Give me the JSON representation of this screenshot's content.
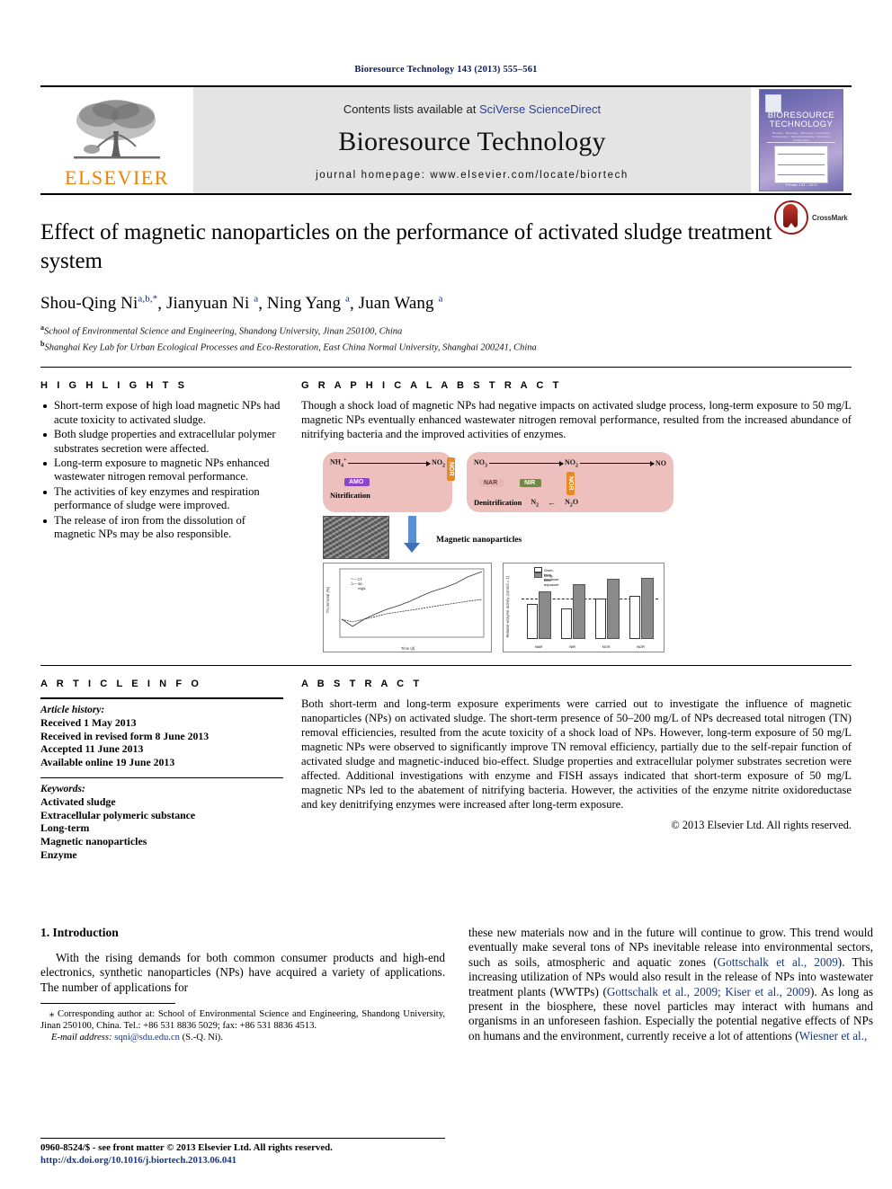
{
  "running_head": "Bioresource Technology 143 (2013) 555–561",
  "masthead": {
    "publisher_wordmark": "ELSEVIER",
    "contents_prefix": "Contents lists available at ",
    "contents_link": "SciVerse ScienceDirect",
    "journal_name": "Bioresource Technology",
    "homepage": "journal homepage: www.elsevier.com/locate/biortech",
    "cover": {
      "line1": "BIORESOURCE",
      "line2": "TECHNOLOGY",
      "subtitle": "Biomass · Bioenergy · Biowastes · Conversion Technologies · Biotransformations · Production Technologies",
      "footer": "Volume 143 / 2013"
    }
  },
  "article": {
    "title": "Effect of magnetic nanoparticles on the performance of activated sludge treatment system",
    "crossmark_label": "CrossMark",
    "authors": [
      {
        "name": "Shou-Qing Ni",
        "marks": "a,b,*"
      },
      {
        "name": "Jianyuan Ni",
        "marks": "a"
      },
      {
        "name": "Ning Yang",
        "marks": "a"
      },
      {
        "name": "Juan Wang",
        "marks": "a"
      }
    ],
    "affiliations": [
      {
        "mark": "a",
        "text": "School of Environmental Science and Engineering, Shandong University, Jinan 250100, China"
      },
      {
        "mark": "b",
        "text": "Shanghai Key Lab for Urban Ecological Processes and Eco-Restoration, East China Normal University, Shanghai 200241, China"
      }
    ]
  },
  "highlights": {
    "heading": "H I G H L I G H T S",
    "items": [
      "Short-term expose of high load magnetic NPs had acute toxicity to activated sludge.",
      "Both sludge properties and extracellular polymer substrates secretion were affected.",
      "Long-term exposure to magnetic NPs enhanced wastewater nitrogen removal performance.",
      "The activities of key enzymes and respiration performance of sludge were improved.",
      "The release of iron from the dissolution of magnetic NPs may be also responsible."
    ]
  },
  "graphical_abstract": {
    "heading": "G R A P H I C A L   A B S T R A C T",
    "summary": "Though a shock load of magnetic NPs had negative impacts on activated sludge process, long-term exposure to 50 mg/L magnetic NPs eventually enhanced wastewater nitrogen removal performance, resulted from the increased abundance of nitrifying bacteria and the improved activities of enzymes.",
    "diagram": {
      "nitrification": {
        "label": "Nitrification",
        "species": [
          "NH₄⁺",
          "NO₂"
        ],
        "enzymes": [
          "AMO"
        ]
      },
      "denitrification": {
        "label": "Denitrification",
        "species": [
          "NO₃",
          "NO₂",
          "NO",
          "N₂O",
          "N₂"
        ],
        "enzymes": [
          "NAR",
          "NIR",
          "NOR"
        ]
      },
      "shared_enzyme": "NOR",
      "nanoparticle_label": "Magnetic nanoparticles"
    },
    "chart_data": [
      {
        "type": "line",
        "title": "",
        "xlabel": "Time (d)",
        "ylabel": "TN removal (%)",
        "xlim": [
          0,
          60
        ],
        "ylim": [
          50,
          100
        ],
        "x": [
          0,
          5,
          10,
          15,
          20,
          25,
          30,
          35,
          40,
          45,
          50,
          55,
          60
        ],
        "series": [
          {
            "name": "CT",
            "values": [
              68,
              62,
              67,
              71,
              74,
              76,
              79,
              82,
              84,
              86,
              88,
              91,
              95
            ]
          },
          {
            "name": "50 mg/L",
            "values": [
              68,
              66,
              68,
              70,
              72,
              73,
              74,
              75,
              76,
              77,
              78,
              79,
              80
            ]
          }
        ],
        "legend": [
          "CT",
          "50 mg/L"
        ]
      },
      {
        "type": "bar",
        "title": "",
        "xlabel": "",
        "ylabel": "Relative enzyme activity (control = 1)",
        "categories": [
          "NAR",
          "NIR",
          "NOS",
          "NOR"
        ],
        "ylim": [
          0.0,
          1.4
        ],
        "series": [
          {
            "name": "Short-term exposure",
            "values": [
              0.7,
              0.62,
              0.83,
              0.88
            ]
          },
          {
            "name": "Long-term exposure",
            "values": [
              0.97,
              1.12,
              1.23,
              1.26
            ]
          }
        ],
        "reference_line": 1.0,
        "legend": [
          "Short-term exposure",
          "Long-term exposure"
        ]
      }
    ]
  },
  "article_info": {
    "heading": "A R T I C L E   I N F O",
    "history_label": "Article history:",
    "history": [
      "Received 1 May 2013",
      "Received in revised form 8 June 2013",
      "Accepted 11 June 2013",
      "Available online 19 June 2013"
    ],
    "keywords_label": "Keywords:",
    "keywords": [
      "Activated sludge",
      "Extracellular polymeric substance",
      "Long-term",
      "Magnetic nanoparticles",
      "Enzyme"
    ]
  },
  "abstract": {
    "heading": "A B S T R A C T",
    "text": "Both short-term and long-term exposure experiments were carried out to investigate the influence of magnetic nanoparticles (NPs) on activated sludge. The short-term presence of 50–200 mg/L of NPs decreased total nitrogen (TN) removal efficiencies, resulted from the acute toxicity of a shock load of NPs. However, long-term exposure of 50 mg/L magnetic NPs were observed to significantly improve TN removal efficiency, partially due to the self-repair function of activated sludge and magnetic-induced bio-effect. Sludge properties and extracellular polymer substrates secretion were affected. Additional investigations with enzyme and FISH assays indicated that short-term exposure of 50 mg/L magnetic NPs led to the abatement of nitrifying bacteria. However, the activities of the enzyme nitrite oxidoreductase and key denitrifying enzymes were increased after long-term exposure.",
    "copyright": "© 2013 Elsevier Ltd. All rights reserved."
  },
  "body": {
    "section_heading": "1. Introduction",
    "left_paragraph": "With the rising demands for both common consumer products and high-end electronics, synthetic nanoparticles (NPs) have acquired a variety of applications. The number of applications for",
    "right_paragraph_parts": [
      {
        "text": "these new materials now and in the future will continue to grow. This trend would eventually make several tons of NPs inevitable release into environmental sectors, such as soils, atmospheric and aquatic zones (",
        "ref": false
      },
      {
        "text": "Gottschalk et al., 2009",
        "ref": true
      },
      {
        "text": "). This increasing utilization of NPs would also result in the release of NPs into wastewater treatment plants (WWTPs) (",
        "ref": false
      },
      {
        "text": "Gottschalk et al., 2009; Kiser et al., 2009",
        "ref": true
      },
      {
        "text": "). As long as present in the biosphere, these novel particles may interact with humans and organisms in an unforeseen fashion. Especially the potential negative effects of NPs on humans and the environment, currently receive a lot of attentions (",
        "ref": false
      },
      {
        "text": "Wiesner et al.,",
        "ref": true
      }
    ]
  },
  "footnote": {
    "corresponding": "⁎ Corresponding author at: School of Environmental Science and Engineering, Shandong University, Jinan 250100, China. Tel.: +86 531 8836 5029; fax: +86 531 8836 4513.",
    "email_label": "E-mail address:",
    "email": "sqni@sdu.edu.cn",
    "email_suffix": "(S.-Q. Ni)."
  },
  "footer": {
    "issn_line": "0960-8524/$ - see front matter © 2013 Elsevier Ltd. All rights reserved.",
    "doi": "http://dx.doi.org/10.1016/j.biortech.2013.06.041"
  },
  "colors": {
    "link": "#17377e",
    "elsevier_orange": "#F08000",
    "header_navy": "#0b1a5c",
    "masthead_gray": "#e4e4e4"
  }
}
